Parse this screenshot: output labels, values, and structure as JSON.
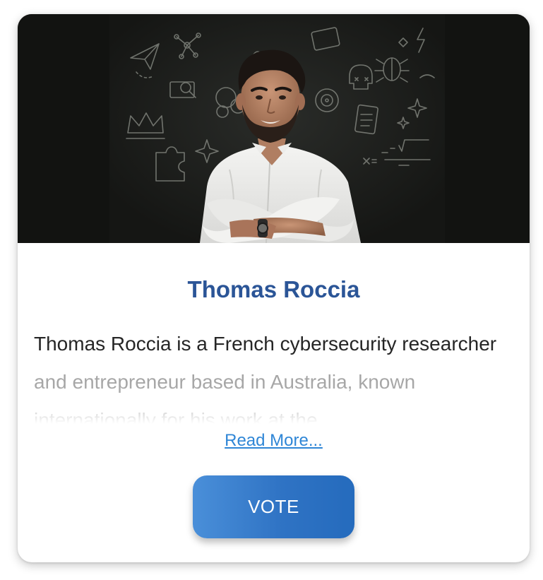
{
  "card": {
    "name": "Thomas Roccia",
    "bio": "Thomas Roccia is a French cybersecurity researcher and entrepreneur based in Australia, known internationally for his work at the",
    "read_more_label": "Read More...",
    "vote_label": "VOTE",
    "photo_alt": "Portrait of Thomas Roccia in front of a chalkboard"
  },
  "colors": {
    "name": "#2b5597",
    "link": "#2f86d6",
    "button_start": "#4a8fd9",
    "button_end": "#256bbd",
    "photo_background": "#141513"
  }
}
